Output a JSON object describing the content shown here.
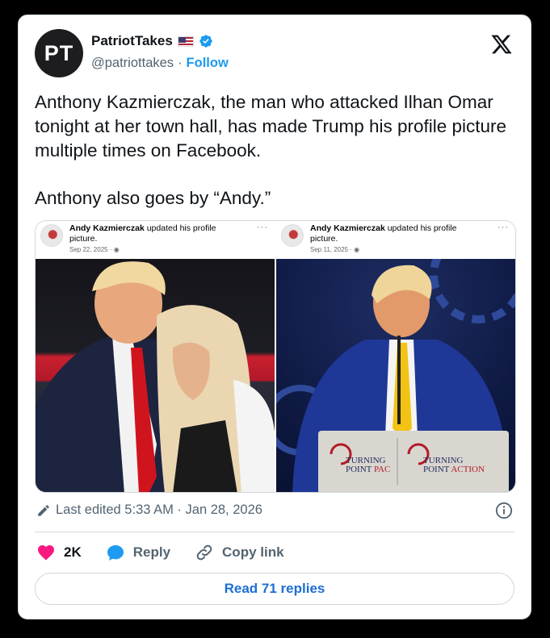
{
  "author": {
    "avatar_text": "PT",
    "name": "PatriotTakes",
    "handle": "@patriottakes",
    "separator": "·",
    "follow_label": "Follow"
  },
  "tweet": {
    "paragraph1": "Anthony Kazmierczak, the man who attacked Ilhan Omar tonight at her town hall, has made Trump his profile picture multiple times on Facebook.",
    "paragraph2": "Anthony also goes by “Andy.”"
  },
  "media": {
    "left": {
      "poster": "Andy Kazmierczak",
      "action": " updated his profile picture.",
      "date": "Sep 22, 2025 · ",
      "dots": "···"
    },
    "right": {
      "poster": "Andy Kazmierczak",
      "action": " updated his profile picture.",
      "date": "Sep 11, 2025 · ",
      "dots": "···",
      "sign1_line1": "TURNING",
      "sign1_line2a": "POINT ",
      "sign1_line2b": "PAC",
      "sign2_line1": "TURNING",
      "sign2_line2a": "POINT ",
      "sign2_line2b": "ACTION"
    }
  },
  "meta": {
    "edited": "Last edited 5:33 AM · Jan 28, 2026"
  },
  "actions": {
    "like_count": "2K",
    "reply_label": "Reply",
    "copy_label": "Copy link"
  },
  "replies_button": "Read 71 replies",
  "colors": {
    "accent": "#1d9bf0",
    "like": "#f91880",
    "link": "#1d6ed6",
    "muted": "#536471"
  }
}
